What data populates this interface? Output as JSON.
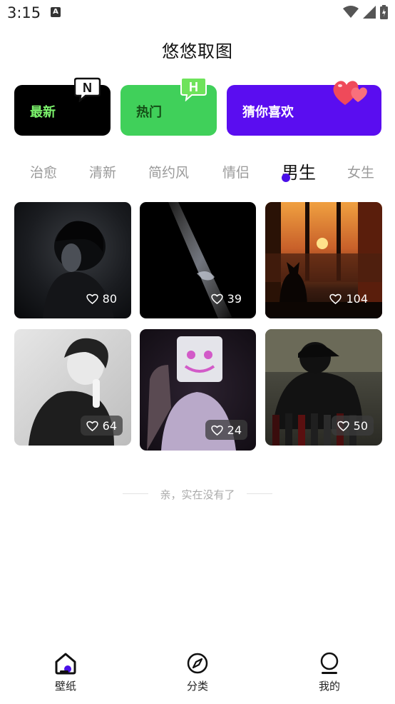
{
  "status": {
    "time": "3:15",
    "notif_letter": "A"
  },
  "header": {
    "title": "悠悠取图"
  },
  "promos": [
    {
      "label": "最新",
      "badge": "N"
    },
    {
      "label": "热门",
      "badge": "H"
    },
    {
      "label": "猜你喜欢",
      "badge_icon": "hearts-icon"
    }
  ],
  "tabs": [
    "治愈",
    "清新",
    "简约风",
    "情侣",
    "男生",
    "女生"
  ],
  "active_tab": "男生",
  "wallpapers": [
    {
      "likes": "80"
    },
    {
      "likes": "39"
    },
    {
      "likes": "104"
    },
    {
      "likes": "64"
    },
    {
      "likes": "24"
    },
    {
      "likes": "50"
    }
  ],
  "end_message": "亲，实在没有了",
  "nav": [
    {
      "label": "壁纸",
      "icon": "home-icon"
    },
    {
      "label": "分类",
      "icon": "compass-icon"
    },
    {
      "label": "我的",
      "icon": "profile-icon"
    }
  ],
  "colors": {
    "accent": "#4a10e8",
    "latest_bg": "#000000",
    "hot_bg": "#40d05a",
    "guess_bg": "#5a0df0"
  }
}
